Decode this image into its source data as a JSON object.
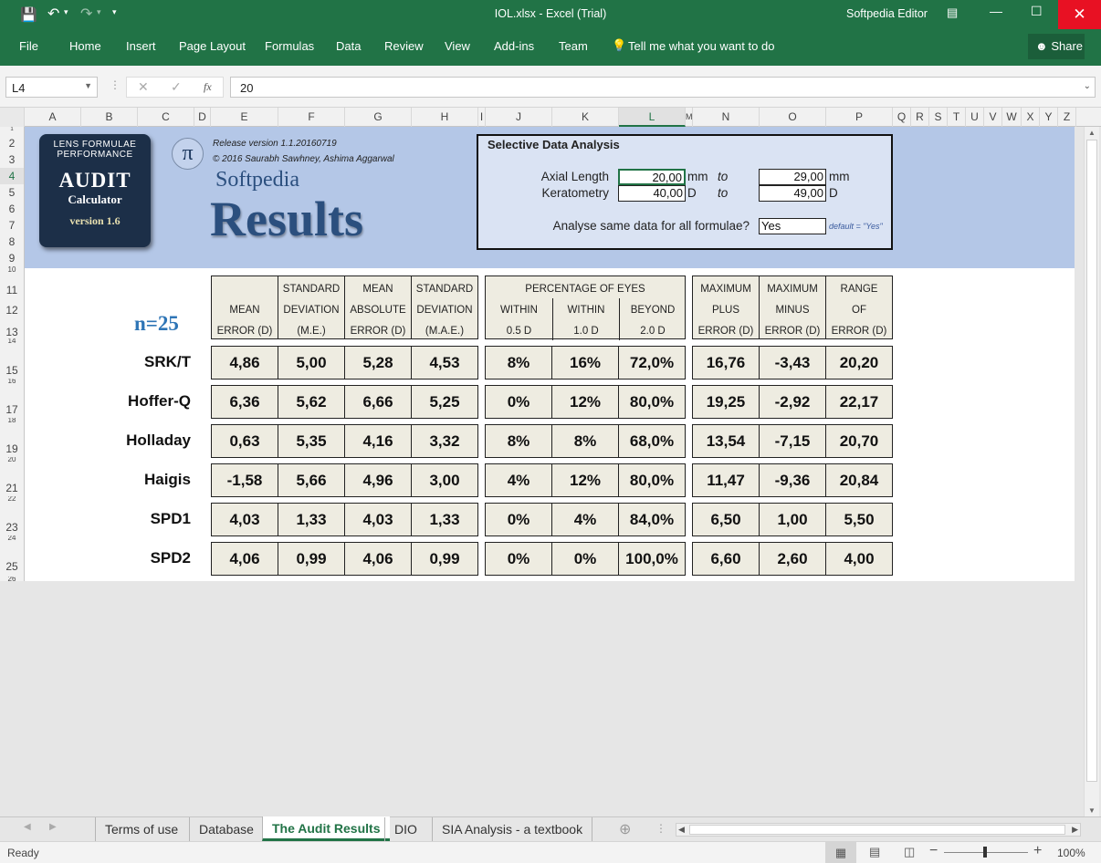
{
  "titlebar": {
    "title": "IOL.xlsx - Excel (Trial)",
    "user": "Softpedia Editor"
  },
  "ribbon": {
    "tabs": [
      "File",
      "Home",
      "Insert",
      "Page Layout",
      "Formulas",
      "Data",
      "Review",
      "View",
      "Add-ins",
      "Team"
    ],
    "tell_me": "Tell me what you want to do",
    "share": "Share"
  },
  "formula_bar": {
    "name_box": "L4",
    "fx": "fx",
    "value": "20"
  },
  "columns": [
    "A",
    "B",
    "C",
    "D",
    "E",
    "F",
    "G",
    "H",
    "I",
    "J",
    "K",
    "L",
    "M",
    "N",
    "O",
    "P",
    "Q",
    "R",
    "S",
    "T",
    "U",
    "V",
    "W",
    "X",
    "Y",
    "Z"
  ],
  "rows": [
    "1",
    "2",
    "3",
    "4",
    "5",
    "6",
    "7",
    "8",
    "9",
    "10",
    "11",
    "12",
    "13",
    "14",
    "15",
    "16",
    "17",
    "18",
    "19",
    "20",
    "21",
    "22",
    "23",
    "24",
    "25",
    "26"
  ],
  "logo": {
    "line1": "LENS FORMULAE",
    "line2": "PERFORMANCE",
    "line3": "AUDIT",
    "line4": "Calculator",
    "line5": "version 1.6"
  },
  "pi_symbol": "π",
  "release": "Release version 1.1.20160719",
  "copyright": "© 2016 Saurabh Sawhney, Ashima Aggarwal",
  "brand": "Softpedia",
  "heading": "Results",
  "selective": {
    "title": "Selective Data Analysis",
    "axial_label": "Axial Length",
    "axial_from": "20,00",
    "axial_unit1": "mm",
    "to1": "to",
    "axial_to": "29,00",
    "axial_unit2": "mm",
    "kerato_label": "Keratometry",
    "kerato_from": "40,00",
    "kerato_unit1": "D",
    "to2": "to",
    "kerato_to": "49,00",
    "kerato_unit2": "D",
    "analyse_label": "Analyse same data for all formulae?",
    "analyse_value": "Yes",
    "default_note": "default = \"Yes\""
  },
  "n_label": "n=25",
  "headers": {
    "mean": [
      "MEAN",
      "ERROR (D)"
    ],
    "sd_me": [
      "STANDARD",
      "DEVIATION",
      "(M.E.)"
    ],
    "mae": [
      "MEAN",
      "ABSOLUTE",
      "ERROR (D)"
    ],
    "sd_mae": [
      "STANDARD",
      "DEVIATION",
      "(M.A.E.)"
    ],
    "pct_title": "PERCENTAGE OF EYES",
    "within05": [
      "WITHIN",
      "0.5 D"
    ],
    "within10": [
      "WITHIN",
      "1.0 D"
    ],
    "beyond20": [
      "BEYOND",
      "2.0 D"
    ],
    "max_plus": [
      "MAXIMUM",
      "PLUS",
      "ERROR (D)"
    ],
    "max_minus": [
      "MAXIMUM",
      "MINUS",
      "ERROR (D)"
    ],
    "range": [
      "RANGE",
      "OF",
      "ERROR (D)"
    ]
  },
  "results": [
    {
      "name": "SRK/T",
      "values": [
        "4,86",
        "5,00",
        "5,28",
        "4,53",
        "8%",
        "16%",
        "72,0%",
        "16,76",
        "-3,43",
        "20,20"
      ]
    },
    {
      "name": "Hoffer-Q",
      "values": [
        "6,36",
        "5,62",
        "6,66",
        "5,25",
        "0%",
        "12%",
        "80,0%",
        "19,25",
        "-2,92",
        "22,17"
      ]
    },
    {
      "name": "Holladay",
      "values": [
        "0,63",
        "5,35",
        "4,16",
        "3,32",
        "8%",
        "8%",
        "68,0%",
        "13,54",
        "-7,15",
        "20,70"
      ]
    },
    {
      "name": "Haigis",
      "values": [
        "-1,58",
        "5,66",
        "4,96",
        "3,00",
        "4%",
        "12%",
        "80,0%",
        "11,47",
        "-9,36",
        "20,84"
      ]
    },
    {
      "name": "SPD1",
      "values": [
        "4,03",
        "1,33",
        "4,03",
        "1,33",
        "0%",
        "4%",
        "84,0%",
        "6,50",
        "1,00",
        "5,50"
      ]
    },
    {
      "name": "SPD2",
      "values": [
        "4,06",
        "0,99",
        "4,06",
        "0,99",
        "0%",
        "0%",
        "100,0%",
        "6,60",
        "2,60",
        "4,00"
      ]
    }
  ],
  "sheet_tabs": [
    "Terms of use",
    "Database",
    "The Audit Results",
    "DIO",
    "SIA Analysis - a textbook"
  ],
  "active_tab": "The Audit Results",
  "status": {
    "ready": "Ready",
    "zoom": "100%"
  }
}
